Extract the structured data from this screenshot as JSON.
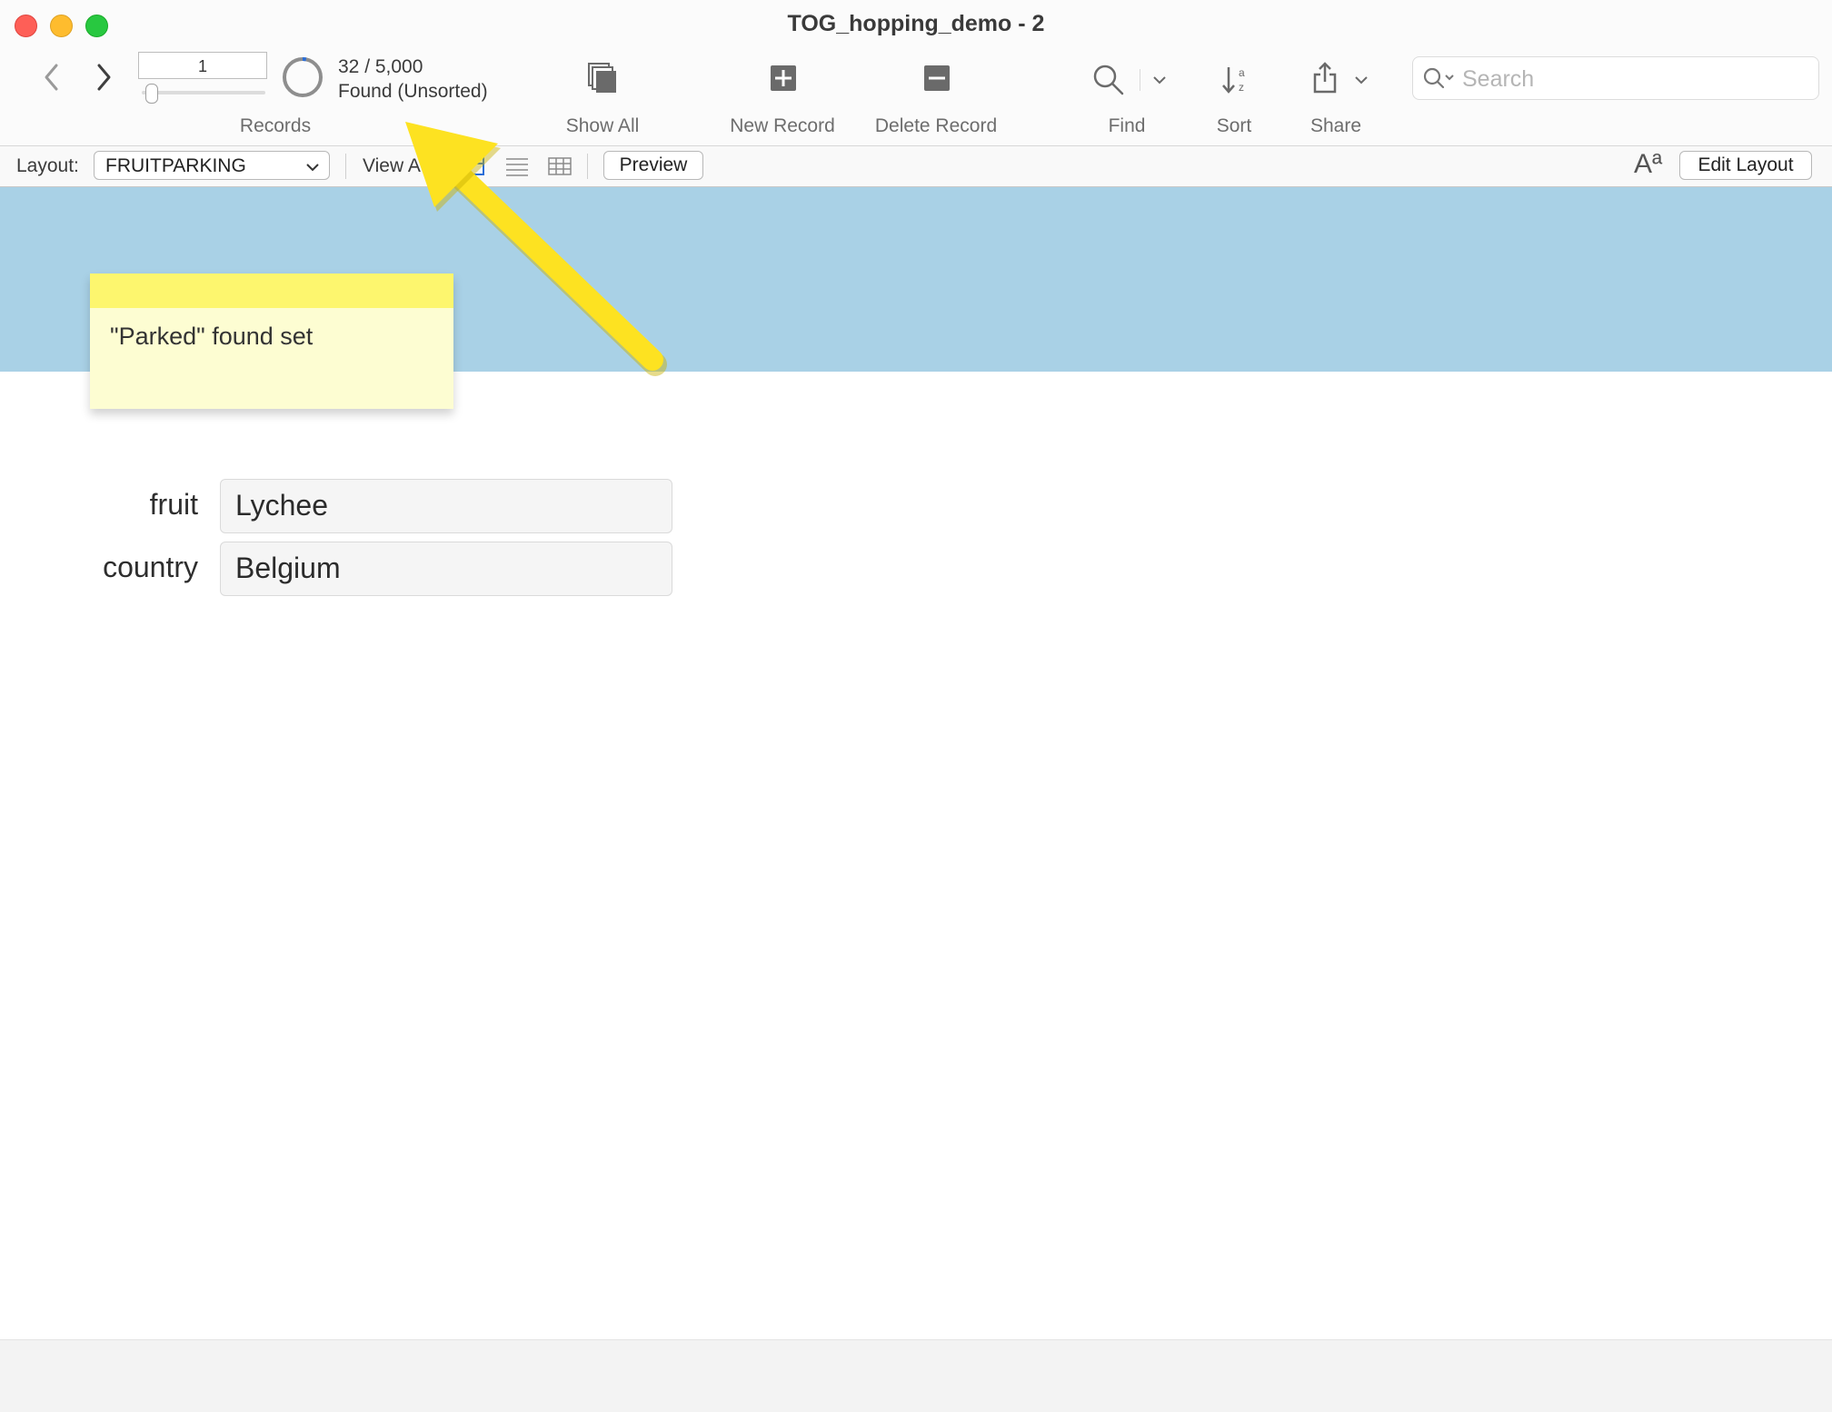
{
  "window": {
    "title": "TOG_hopping_demo - 2"
  },
  "records": {
    "current_record": "1",
    "found_count": "32 / 5,000",
    "found_status": "Found (Unsorted)",
    "label": "Records",
    "found_fraction": 0.0064
  },
  "toolbar": {
    "show_all": "Show All",
    "new_record": "New Record",
    "delete_record": "Delete Record",
    "find": "Find",
    "sort": "Sort",
    "share": "Share"
  },
  "search": {
    "placeholder": "Search"
  },
  "layoutbar": {
    "layout_label": "Layout:",
    "layout_value": "FRUITPARKING",
    "view_label": "View A",
    "preview": "Preview",
    "edit_layout": "Edit Layout",
    "text_size_glyph": "Aª"
  },
  "note": {
    "text": "\"Parked\" found set"
  },
  "fields": [
    {
      "label": "fruit",
      "value": "Lychee"
    },
    {
      "label": "country",
      "value": "Belgium"
    }
  ],
  "colors": {
    "header_band": "#a9d1e6",
    "sticky_note": "#fdfdd2",
    "sticky_strip": "#fdf66e",
    "arrow": "#fde221",
    "pie_accent": "#2a6ed8"
  }
}
